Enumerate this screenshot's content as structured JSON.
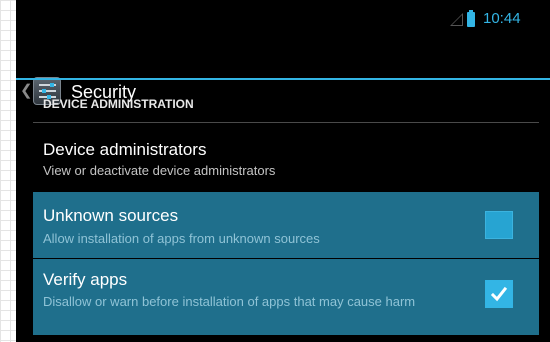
{
  "status_bar": {
    "time": "10:44",
    "accent_color": "#33b5e5"
  },
  "action_bar": {
    "title": "Security",
    "up_icon": "chevron-left-icon",
    "app_icon": "settings-icon",
    "accent_color": "#33b5e5"
  },
  "section": {
    "header": "DEVICE ADMINISTRATION"
  },
  "preferences": [
    {
      "title": "Device administrators",
      "summary": "View or deactivate device administrators"
    },
    {
      "title": "Unknown sources",
      "summary": "Allow installation of apps from unknown sources",
      "checked": false
    },
    {
      "title": "Verify apps",
      "summary": "Disallow or warn before installation of apps that may cause harm",
      "checked": true
    }
  ],
  "colors": {
    "background": "#000000",
    "selected_row": "#1f6f8c",
    "checkbox": "#33b5e5"
  }
}
